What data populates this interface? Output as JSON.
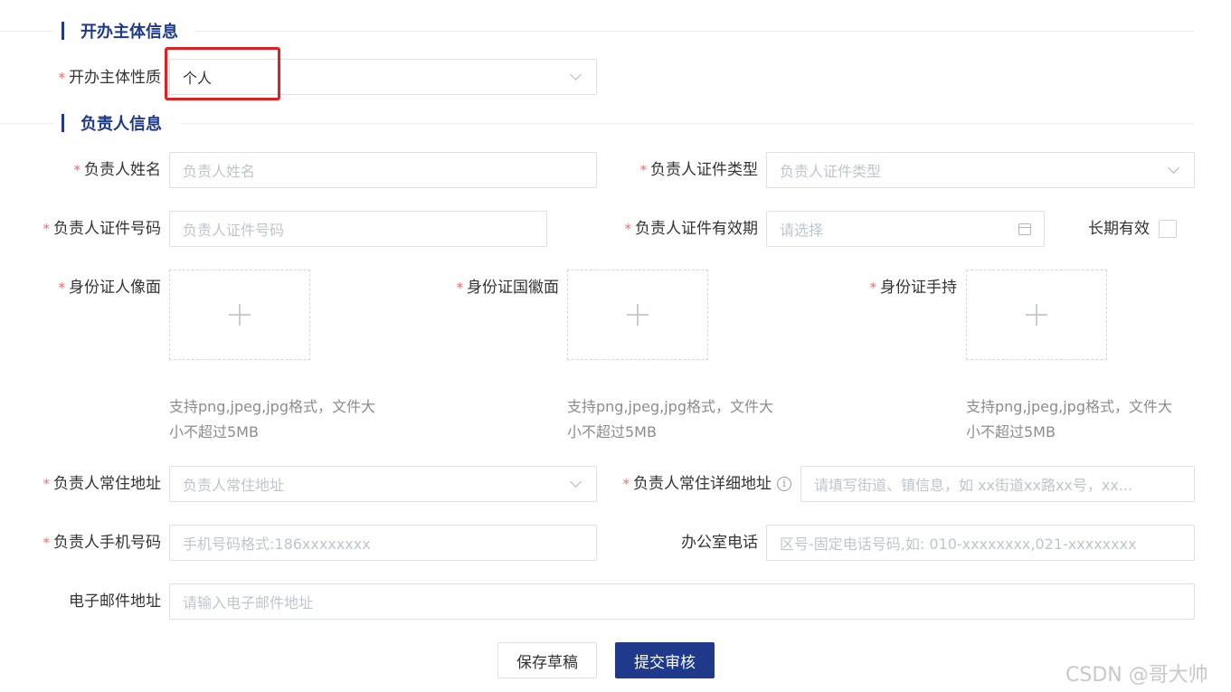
{
  "sections": {
    "entity_title": "开办主体信息",
    "person_title": "负责人信息"
  },
  "entity": {
    "nature_label": "开办主体性质",
    "nature_value": "个人"
  },
  "person": {
    "name_label": "负责人姓名",
    "name_placeholder": "负责人姓名",
    "id_type_label": "负责人证件类型",
    "id_type_placeholder": "负责人证件类型",
    "id_number_label": "负责人证件号码",
    "id_number_placeholder": "负责人证件号码",
    "id_validity_label": "负责人证件有效期",
    "id_validity_placeholder": "请选择",
    "long_term_label": "长期有效",
    "id_front_label": "身份证人像面",
    "id_back_label": "身份证国徽面",
    "id_hand_label": "身份证手持",
    "upload_hint_line1": "支持png,jpeg,jpg格式，文件大",
    "upload_hint_line2": "小不超过5MB",
    "address_label": "负责人常住地址",
    "address_placeholder": "负责人常住地址",
    "detail_address_label": "负责人常住详细地址",
    "detail_address_placeholder": "请填写街道、镇信息，如 xx街道xx路xx号，xx...",
    "mobile_label": "负责人手机号码",
    "mobile_placeholder": "手机号码格式:186xxxxxxxx",
    "office_phone_label": "办公室电话",
    "office_phone_placeholder": "区号-固定电话号码,如: 010-xxxxxxxx,021-xxxxxxxx",
    "email_label": "电子邮件地址",
    "email_placeholder": "请输入电子邮件地址"
  },
  "required_mark": "*",
  "info_icon_glyph": "i",
  "actions": {
    "save_draft": "保存草稿",
    "submit": "提交审核"
  },
  "watermark": "CSDN @哥大帅",
  "colors": {
    "accent": "#1f3a8a",
    "required": "#f56c6c",
    "highlight": "#e02020"
  }
}
